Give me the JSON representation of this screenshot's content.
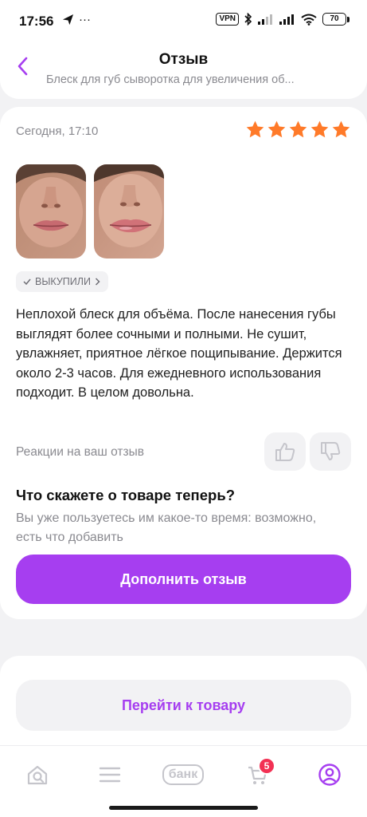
{
  "status_bar": {
    "time": "17:56",
    "dots": "···",
    "vpn": "VPN",
    "battery": "70"
  },
  "header": {
    "title": "Отзыв",
    "subtitle": "Блеск для губ сыворотка для увеличения об..."
  },
  "review": {
    "date": "Сегодня, 17:10",
    "rating": 5,
    "photos_count": 2,
    "bought_badge": "ВЫКУПИЛИ",
    "text": "Неплохой блеск для объёма. После нанесения губы выглядят более сочными и полными. Не сушит, увлажняет, приятное лёгкое пощипывание. Держится около 2-3 часов. Для ежедневного использования подходит. В целом довольна.",
    "reactions_label": "Реакции на ваш отзыв"
  },
  "followup": {
    "title": "Что скажете о товаре теперь?",
    "subtitle": "Вы уже пользуетесь им какое-то время: возможно, есть что добавить",
    "button": "Дополнить отзыв"
  },
  "go_to_product": "Перейти к товару",
  "tabbar": {
    "bank_label": "банк",
    "cart_count": "5"
  },
  "colors": {
    "accent": "#a63ef0",
    "star": "#ff7a29",
    "badge": "#f23154"
  }
}
